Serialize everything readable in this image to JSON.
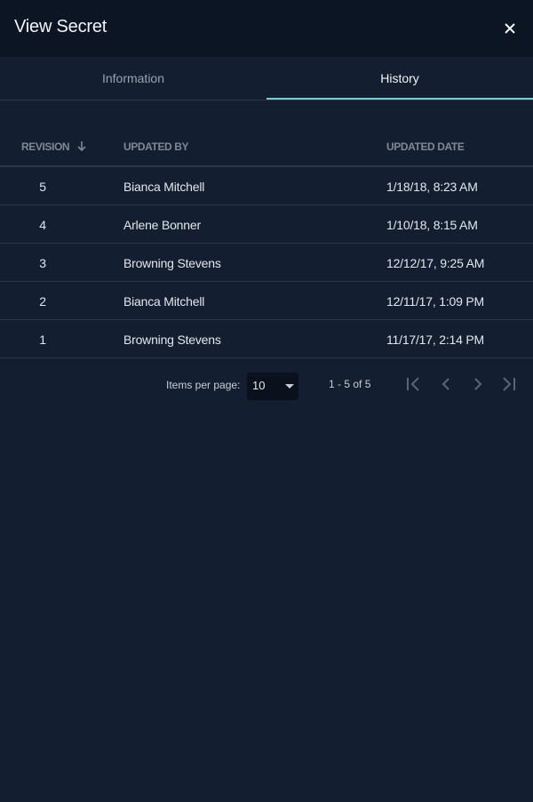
{
  "dialog": {
    "title": "View Secret",
    "close_icon": "close-icon"
  },
  "tabs": [
    {
      "label": "Information",
      "active": false
    },
    {
      "label": "History",
      "active": true
    }
  ],
  "colors": {
    "accent": "#6fd0cf",
    "header_bg": "#0c1523",
    "body_bg": "#131e30",
    "divider": "#2b3647"
  },
  "table": {
    "columns": [
      {
        "label": "REVISION",
        "sort": "descending",
        "sort_icon": "arrow-down-icon"
      },
      {
        "label": "UPDATED BY"
      },
      {
        "label": "UPDATED DATE"
      }
    ],
    "rows": [
      {
        "revision": "5",
        "updated_by": "Bianca Mitchell",
        "updated_date": "1/18/18, 8:23 AM"
      },
      {
        "revision": "4",
        "updated_by": "Arlene Bonner",
        "updated_date": "1/10/18, 8:15 AM"
      },
      {
        "revision": "3",
        "updated_by": "Browning Stevens",
        "updated_date": "12/12/17, 9:25 AM"
      },
      {
        "revision": "2",
        "updated_by": "Bianca Mitchell",
        "updated_date": "12/11/17, 1:09 PM"
      },
      {
        "revision": "1",
        "updated_by": "Browning Stevens",
        "updated_date": "11/17/17, 2:14 PM"
      }
    ]
  },
  "paginator": {
    "items_per_page_label": "Items per page:",
    "items_per_page_value": "10",
    "range_label": "1 - 5 of 5",
    "buttons": [
      "first-page-icon",
      "previous-page-icon",
      "next-page-icon",
      "last-page-icon"
    ]
  }
}
